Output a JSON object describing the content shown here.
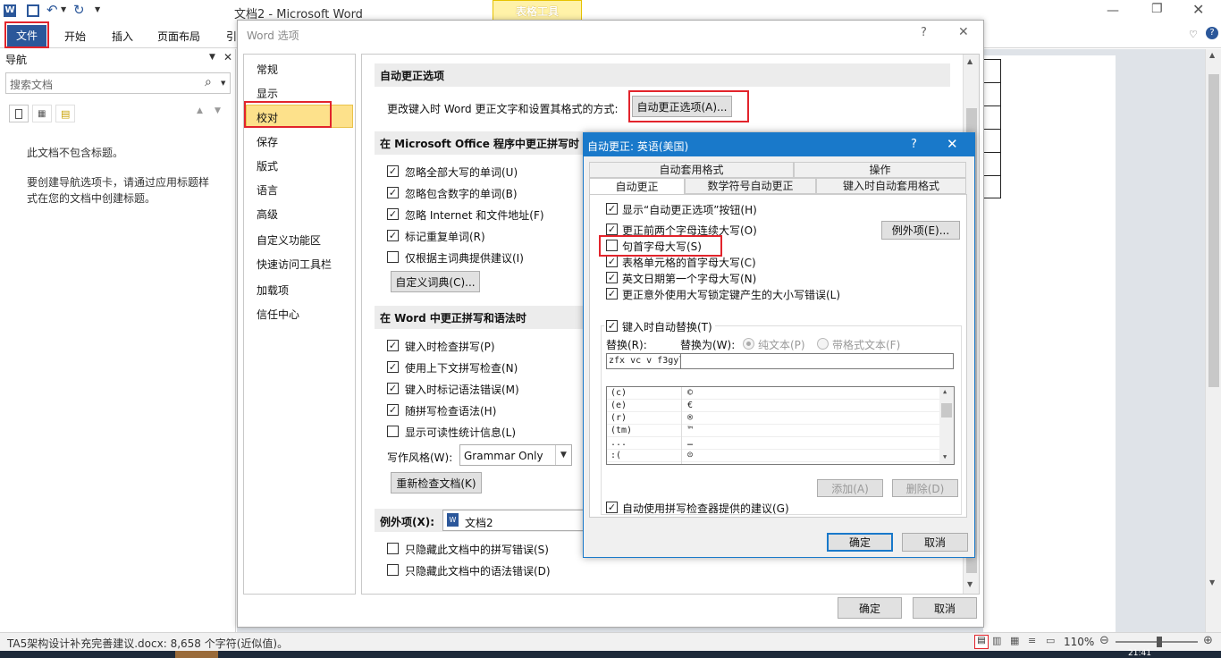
{
  "word": {
    "title": "文档2 - Microsoft Word",
    "table_tools": "表格工具",
    "tabs": [
      "文件",
      "开始",
      "插入",
      "页面布局",
      "引"
    ],
    "status_text": "TA5架构设计补充完善建议.docx: 8,658 个字符(近似值)。",
    "zoom": "110%",
    "clock": "21:41"
  },
  "nav": {
    "title": "导航",
    "search_placeholder": "搜索文档",
    "no_headings": "此文档不包含标题。",
    "hint": "要创建导航选项卡，请通过应用标题样式在您的文档中创建标题。"
  },
  "options": {
    "title": "Word 选项",
    "help": "?",
    "sidebar": [
      "常规",
      "显示",
      "校对",
      "保存",
      "版式",
      "语言",
      "高级",
      "自定义功能区",
      "快速访问工具栏",
      "加载项",
      "信任中心"
    ],
    "autocorrect_header": "自动更正选项",
    "autocorrect_desc": "更改键入时 Word 更正文字和设置其格式的方式:",
    "autocorrect_btn": "自动更正选项(A)...",
    "office_header": "在 Microsoft Office 程序中更正拼写时",
    "office_checks": [
      "忽略全部大写的单词(U)",
      "忽略包含数字的单词(B)",
      "忽略 Internet 和文件地址(F)",
      "标记重复单词(R)",
      "仅根据主词典提供建议(I)"
    ],
    "custom_dict_btn": "自定义词典(C)...",
    "word_header": "在 Word 中更正拼写和语法时",
    "word_checks": [
      "键入时检查拼写(P)",
      "使用上下文拼写检查(N)",
      "键入时标记语法错误(M)",
      "随拼写检查语法(H)",
      "显示可读性统计信息(L)"
    ],
    "style_label": "写作风格(W):",
    "style_value": "Grammar Only",
    "recheck_btn": "重新检查文档(K)",
    "exceptions_label": "例外项(X):",
    "exceptions_doc": "文档2",
    "exceptions_checks": [
      "只隐藏此文档中的拼写错误(S)",
      "只隐藏此文档中的语法错误(D)"
    ],
    "ok": "确定",
    "cancel": "取消"
  },
  "autocorrect": {
    "title": "自动更正: 英语(美国)",
    "help": "?",
    "tabs_row1": [
      "自动套用格式",
      "操作"
    ],
    "tabs_row2": [
      "自动更正",
      "数学符号自动更正",
      "键入时自动套用格式"
    ],
    "show_buttons": "显示“自动更正选项”按钮(H)",
    "exceptions_btn": "例外项(E)...",
    "checks": [
      "更正前两个字母连续大写(O)",
      "句首字母大写(S)",
      "表格单元格的首字母大写(C)",
      "英文日期第一个字母大写(N)",
      "更正意外使用大写锁定键产生的大小写错误(L)"
    ],
    "replace_as_you_type": "键入时自动替换(T)",
    "replace_label": "替换(R):",
    "with_label": "替换为(W):",
    "plain_text": "纯文本(P)",
    "formatted_text": "带格式文本(F)",
    "replace_value": "zfx vc v f3gyl",
    "table": [
      [
        "(c)",
        "©"
      ],
      [
        "(e)",
        "€"
      ],
      [
        "(r)",
        "®"
      ],
      [
        "(tm)",
        "™"
      ],
      [
        "...",
        "…"
      ],
      [
        ":(",
        "☹"
      ]
    ],
    "add_btn": "添加(A)",
    "delete_btn": "删除(D)",
    "use_spell": "自动使用拼写检查器提供的建议(G)",
    "ok": "确定",
    "cancel": "取消"
  }
}
